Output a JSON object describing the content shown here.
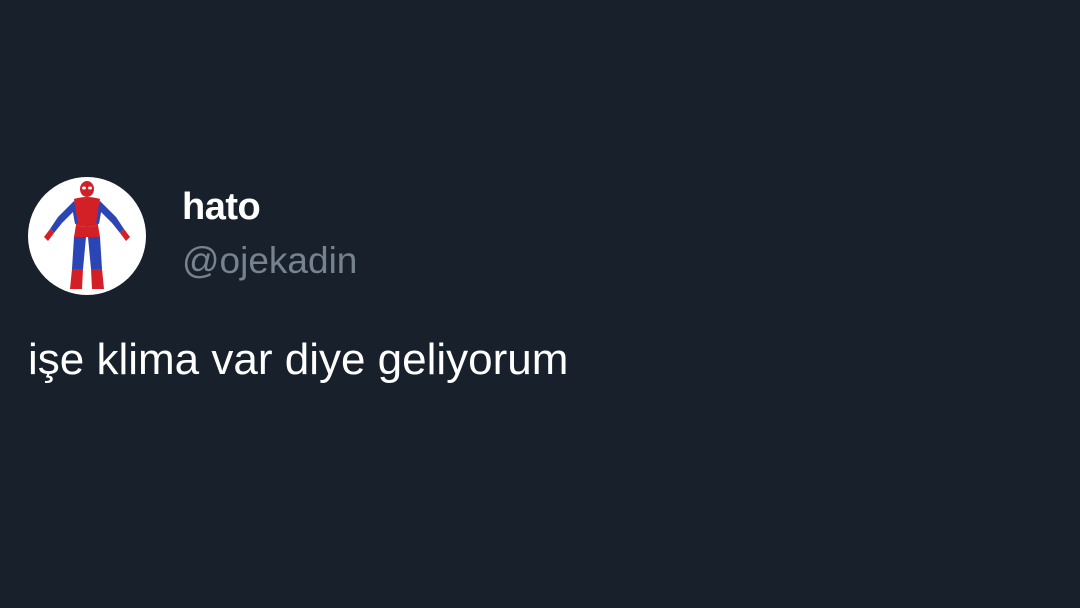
{
  "tweet": {
    "author": {
      "display_name": "hato",
      "handle": "@ojekadin",
      "avatar_icon": "spiderman-avatar-icon"
    },
    "text": "işe klima var diye geliyorum"
  },
  "colors": {
    "background": "#17202b",
    "text_primary": "#ffffff",
    "text_secondary": "#76838f",
    "avatar_bg": "#ffffff"
  }
}
